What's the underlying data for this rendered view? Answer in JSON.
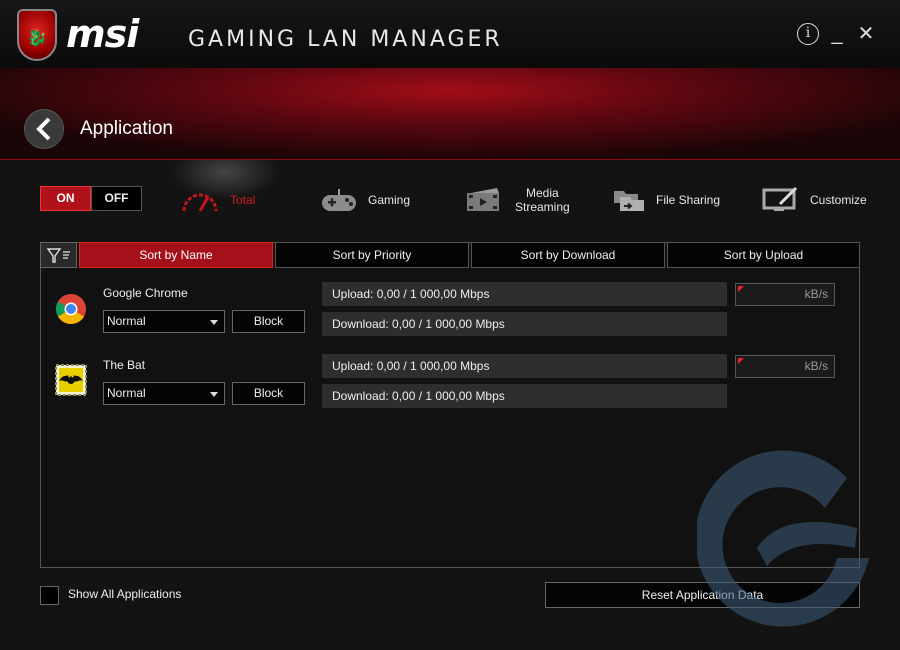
{
  "app": {
    "brand": "msi",
    "title": "GAMING LAN MANAGER",
    "window_buttons": {
      "info": "i",
      "minimize": "_",
      "close": "✕"
    }
  },
  "header": {
    "title": "Application"
  },
  "toggle": {
    "on_label": "ON",
    "off_label": "OFF",
    "active": "ON"
  },
  "categories": [
    {
      "label": "Total",
      "icon": "speedometer-icon",
      "active": true
    },
    {
      "label": "Gaming",
      "icon": "gamepad-icon"
    },
    {
      "label": "Media\nStreaming",
      "icon": "film-icon"
    },
    {
      "label": "File Sharing",
      "icon": "file-sharing-icon"
    },
    {
      "label": "Customize",
      "icon": "monitor-edit-icon"
    }
  ],
  "sort_tabs": [
    {
      "label": "Sort by Name",
      "active": true
    },
    {
      "label": "Sort by Priority"
    },
    {
      "label": "Sort by Download"
    },
    {
      "label": "Sort by Upload"
    }
  ],
  "apps": [
    {
      "name": "Google Chrome",
      "icon": "chrome-icon",
      "priority": "Normal",
      "block_label": "Block",
      "upload": "Upload: 0,00 / 1 000,00 Mbps",
      "download": "Download: 0,00 / 1 000,00 Mbps",
      "limit_unit": "kB/s"
    },
    {
      "name": "The Bat",
      "icon": "bat-icon",
      "priority": "Normal",
      "block_label": "Block",
      "upload": "Upload: 0,00 / 1 000,00 Mbps",
      "download": "Download: 0,00 / 1 000,00 Mbps",
      "limit_unit": "kB/s"
    }
  ],
  "footer": {
    "show_all_label": "Show All Applications",
    "show_all_checked": false,
    "reset_label": "Reset Application Data"
  },
  "colors": {
    "accent": "#b0121b",
    "background": "#131313",
    "panel": "#111111"
  }
}
